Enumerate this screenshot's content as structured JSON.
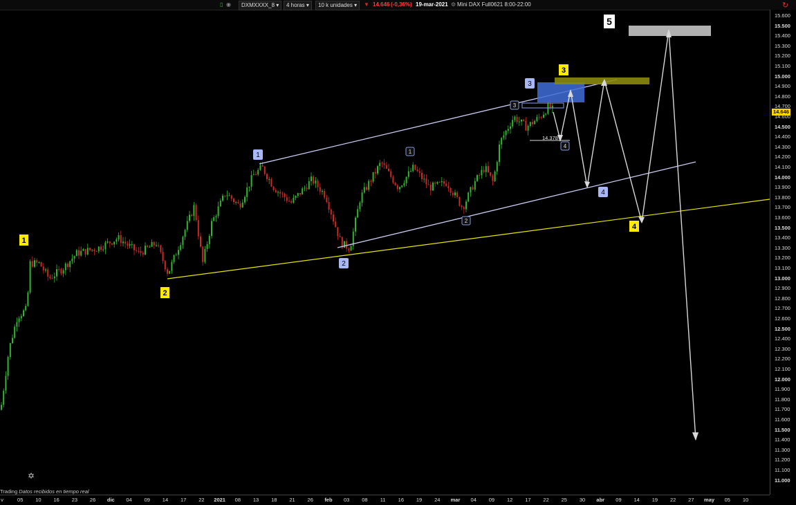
{
  "toolbar": {
    "symbol": "DXMXXXX_8",
    "timeframe": "4 horas",
    "units": "10 k unidades",
    "price": "14.646",
    "change": "(-0,36%)",
    "date": "19-mar-2021",
    "instrument": "Mini DAX Full0621 8:00-22:00"
  },
  "footer": {
    "prefix": "Trading",
    "status": "Datos recibidos en tiempo real"
  },
  "colors": {
    "up": "#2fb82f",
    "down": "#d02727",
    "yellow_line": "#e8e800",
    "channel_line": "#c0c4e8",
    "label_yellow": "#ffeb00",
    "label_blue": "#a9b8f5",
    "blue_box": "#3f6fd8",
    "olive_box": "#8a8a10",
    "gray_box": "#b0b0b0",
    "price_tag": "#ffd600"
  },
  "chart_data": {
    "type": "candlestick",
    "yaxis": {
      "min": 11.0,
      "max": 15.6,
      "step": 0.1,
      "labels": [
        "15.600",
        "15.500",
        "15.400",
        "15.300",
        "15.200",
        "15.100",
        "15.000",
        "14.900",
        "14.800",
        "14.700",
        "14.600",
        "14.500",
        "14.400",
        "14.300",
        "14.200",
        "14.100",
        "14.000",
        "13.900",
        "13.800",
        "13.700",
        "13.600",
        "13.500",
        "13.400",
        "13.300",
        "13.200",
        "13.100",
        "13.000",
        "12.900",
        "12.800",
        "12.700",
        "12.600",
        "12.500",
        "12.400",
        "12.300",
        "12.200",
        "12.100",
        "12.000",
        "11.900",
        "11.800",
        "11.700",
        "11.600",
        "11.500",
        "11.400",
        "11.300",
        "11.200",
        "11.100",
        "11.000"
      ],
      "bold": [
        "15.500",
        "15.000",
        "14.500",
        "14.000",
        "13.500",
        "13.000",
        "12.500",
        "12.000",
        "11.500",
        "11.000"
      ],
      "current_price": 14.646,
      "current_price_label": "14.646"
    },
    "xaxis": {
      "labels": [
        "v",
        "05",
        "10",
        "16",
        "23",
        "26",
        "dic",
        "04",
        "09",
        "14",
        "17",
        "22",
        "2021",
        "08",
        "13",
        "18",
        "21",
        "26",
        "feb",
        "03",
        "08",
        "11",
        "16",
        "19",
        "24",
        "mar",
        "04",
        "09",
        "12",
        "17",
        "22",
        "25",
        "30",
        "abr",
        "09",
        "14",
        "19",
        "22",
        "27",
        "may",
        "05",
        "10"
      ],
      "bold": [
        "dic",
        "2021",
        "feb",
        "mar",
        "abr",
        "may"
      ]
    },
    "price_path": [
      [
        0,
        11.7
      ],
      [
        12,
        12.3
      ],
      [
        24,
        12.62
      ],
      [
        38,
        12.7
      ],
      [
        42,
        13.15
      ],
      [
        56,
        13.15
      ],
      [
        70,
        13.0
      ],
      [
        90,
        13.1
      ],
      [
        110,
        13.25
      ],
      [
        140,
        13.3
      ],
      [
        170,
        13.4
      ],
      [
        200,
        13.25
      ],
      [
        225,
        13.35
      ],
      [
        242,
        13.05
      ],
      [
        262,
        13.4
      ],
      [
        280,
        13.72
      ],
      [
        292,
        13.15
      ],
      [
        305,
        13.55
      ],
      [
        325,
        13.85
      ],
      [
        345,
        13.72
      ],
      [
        365,
        14.02
      ],
      [
        378,
        14.1
      ],
      [
        395,
        13.9
      ],
      [
        420,
        13.75
      ],
      [
        450,
        13.98
      ],
      [
        470,
        13.82
      ],
      [
        492,
        13.35
      ],
      [
        505,
        13.3
      ],
      [
        520,
        13.8
      ],
      [
        550,
        14.15
      ],
      [
        575,
        13.9
      ],
      [
        597,
        14.1
      ],
      [
        620,
        13.9
      ],
      [
        645,
        13.95
      ],
      [
        668,
        13.7
      ],
      [
        685,
        13.95
      ],
      [
        700,
        14.1
      ],
      [
        712,
        13.95
      ],
      [
        722,
        14.35
      ],
      [
        742,
        14.6
      ],
      [
        760,
        14.5
      ],
      [
        780,
        14.6
      ],
      [
        792,
        14.7
      ],
      [
        800,
        14.66
      ]
    ],
    "annotations": {
      "low_label": "14.378",
      "yellow_labels": [
        "1",
        "2",
        "3",
        "4"
      ],
      "blue_labels": [
        "1",
        "2",
        "3",
        "4"
      ],
      "small_labels": [
        "1",
        "2",
        "3",
        "4"
      ],
      "wave5_label": "5"
    }
  }
}
